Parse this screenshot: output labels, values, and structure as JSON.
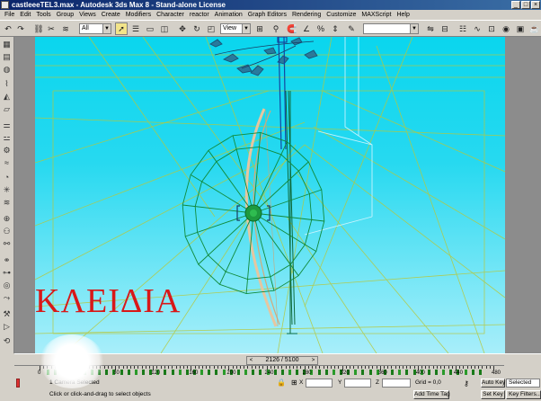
{
  "window": {
    "title": "castleeeTEL3.max - Autodesk 3ds Max 8 - Stand-alone License",
    "controls": [
      "_",
      "□",
      "×"
    ]
  },
  "menu": [
    "File",
    "Edit",
    "Tools",
    "Group",
    "Views",
    "Create",
    "Modifiers",
    "Character",
    "reactor",
    "Animation",
    "Graph Editors",
    "Rendering",
    "Customize",
    "MAXScript",
    "Help"
  ],
  "toolbar": {
    "selection_filter": "All",
    "reference_coord": "View",
    "named_selection": ""
  },
  "viewport": {
    "overlay_text": "ΚΛΕΙΔΙΑ",
    "overlay_color": "#d81818",
    "bg_color": "#0ad6ee"
  },
  "timeline": {
    "slider_label": "2126 / 5100",
    "slider_left": "<",
    "slider_right": ">",
    "tick_labels": [
      "0",
      "40",
      "80",
      "120",
      "160",
      "200",
      "240",
      "280",
      "320",
      "360",
      "400",
      "440",
      "480"
    ]
  },
  "status": {
    "selection": "1 Camera Selected",
    "prompt": "Click or click-and-drag to select objects",
    "x_label": "X",
    "y_label": "Y",
    "z_label": "Z",
    "grid": "Grid = 0,0",
    "add_time_tag": "Add Time Tag",
    "auto_key": "Auto Key",
    "set_key": "Set Key",
    "key_mode": "Selected",
    "key_filters": "Key Filters..."
  }
}
